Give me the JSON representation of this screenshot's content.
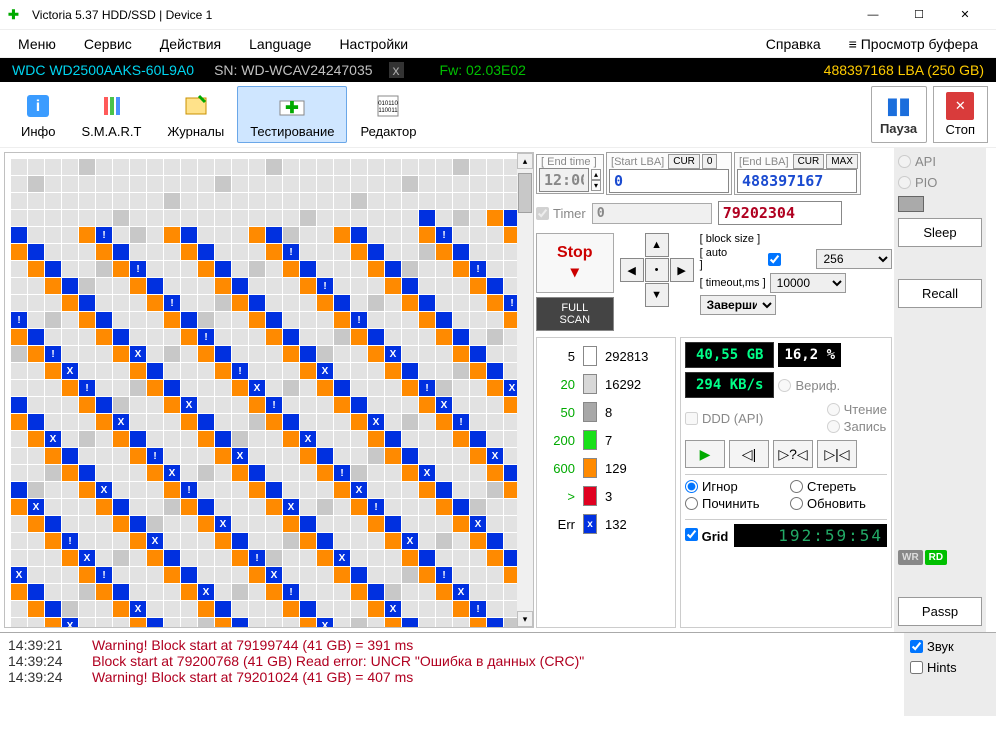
{
  "title": "Victoria 5.37 HDD/SSD | Device 1",
  "menu": {
    "items": [
      "Меню",
      "Сервис",
      "Действия",
      "Language",
      "Настройки",
      "Справка"
    ],
    "right": "Просмотр буфера"
  },
  "device": {
    "model": "WDC WD2500AAKS-60L9A0",
    "sn": "SN: WD-WCAV24247035",
    "fw": "Fw: 02.03E02",
    "lba": "488397168 LBA (250 GB)"
  },
  "toolbar": {
    "info": "Инфо",
    "smart": "S.M.A.R.T",
    "journals": "Журналы",
    "testing": "Тестирование",
    "editor": "Редактор",
    "pause": "Пауза",
    "stop": "Стоп"
  },
  "lba": {
    "end_time_lbl": "[ End time ]",
    "end_time_val": "12:00",
    "start_lbl": "[Start LBA]",
    "start_val": "0",
    "start_cur": "CUR",
    "start_zero": "0",
    "end_lbl": "[End LBA]",
    "end_val": "488397167",
    "end_cur": "CUR",
    "end_max": "MAX",
    "timer_lbl": "Timer",
    "timer_val": "0",
    "current_lba": "79202304"
  },
  "controls": {
    "stop": "Stop",
    "full_scan": "FULL SCAN",
    "block_size_lbl": "[ block size ]",
    "block_size": "256",
    "auto_lbl": "[ auto ]",
    "timeout_lbl": "[ timeout,ms ]",
    "timeout": "10000",
    "finish_lbl": "Завершить"
  },
  "timing": {
    "t5": {
      "lbl": "5",
      "val": "292813"
    },
    "t20": {
      "lbl": "20",
      "val": "16292"
    },
    "t50": {
      "lbl": "50",
      "val": "8"
    },
    "t200": {
      "lbl": "200",
      "val": "7"
    },
    "t600": {
      "lbl": "600",
      "val": "129"
    },
    "tgt": {
      "lbl": ">",
      "val": "3"
    },
    "terr": {
      "lbl": "Err",
      "val": "132",
      "mark": "x"
    }
  },
  "status": {
    "progress_gb": "40,55 GB",
    "progress_pct": "16,2  %",
    "speed": "294 KB/s",
    "verify": "Вериф.",
    "ddd": "DDD (API)",
    "read": "Чтение",
    "write": "Запись",
    "ignore": "Игнор",
    "erase": "Стереть",
    "fix": "Починить",
    "update": "Обновить",
    "grid": "Grid",
    "elapsed": "192:59:54"
  },
  "right": {
    "api": "API",
    "pio": "PIO",
    "sleep": "Sleep",
    "recall": "Recall",
    "passp": "Passp",
    "wr": "WR",
    "rd": "RD"
  },
  "log": [
    {
      "ts": "14:39:21",
      "msg": "Warning! Block start at 79199744 (41 GB)  = 391 ms"
    },
    {
      "ts": "14:39:24",
      "msg": "Block start at 79200768 (41 GB) Read error: UNCR \"Ошибка в данных (CRC)\""
    },
    {
      "ts": "14:39:24",
      "msg": "Warning! Block start at 79201024 (41 GB)  = 407 ms"
    }
  ],
  "log_opts": {
    "sound": "Звук",
    "hints": "Hints"
  }
}
